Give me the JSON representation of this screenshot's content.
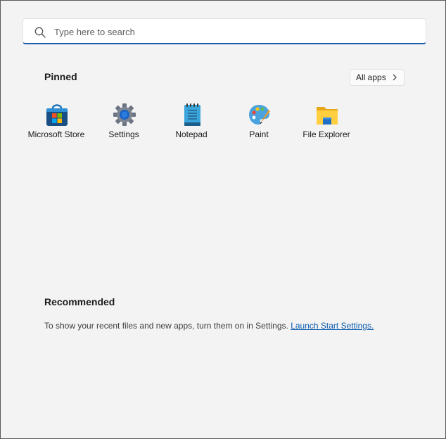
{
  "search": {
    "placeholder": "Type here to search",
    "value": ""
  },
  "pinned": {
    "title": "Pinned",
    "all_apps_label": "All apps",
    "apps": [
      {
        "label": "Microsoft Store",
        "icon": "microsoft-store-icon"
      },
      {
        "label": "Settings",
        "icon": "settings-gear-icon"
      },
      {
        "label": "Notepad",
        "icon": "notepad-icon"
      },
      {
        "label": "Paint",
        "icon": "paint-palette-icon"
      },
      {
        "label": "File Explorer",
        "icon": "folder-icon"
      }
    ]
  },
  "recommended": {
    "title": "Recommended",
    "message": "To show your recent files and new apps, turn them on in Settings.",
    "link_label": "Launch Start Settings."
  },
  "colors": {
    "panel_background": "#f3f3f3",
    "accent": "#1b5fa8",
    "link": "#0b5cad"
  }
}
